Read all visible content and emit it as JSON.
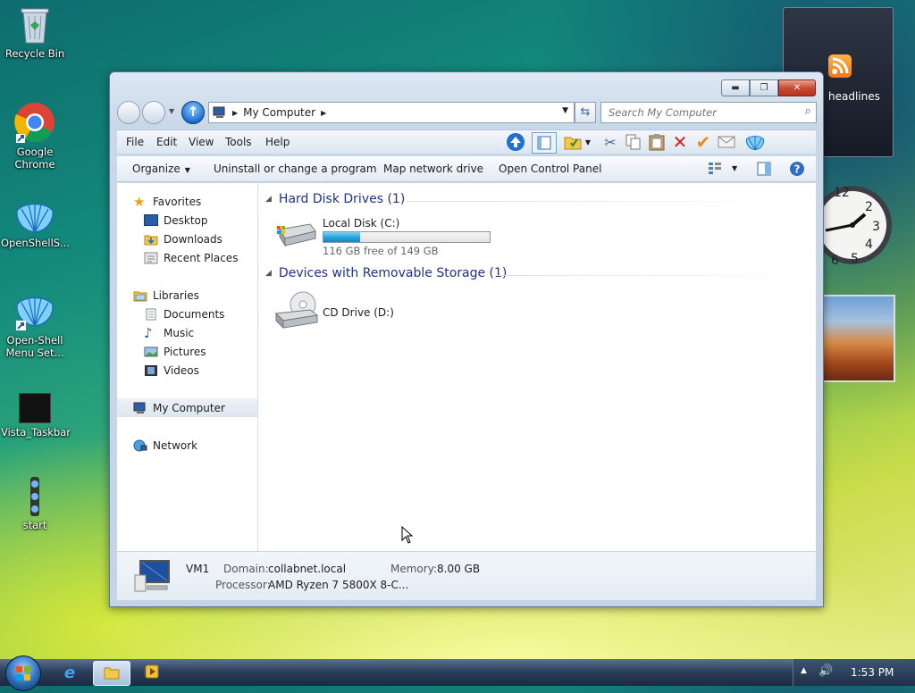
{
  "desktop": {
    "icons": [
      {
        "label": "Recycle Bin"
      },
      {
        "label": "Google Chrome"
      },
      {
        "label": "OpenShellS..."
      },
      {
        "label": "Open-Shell Menu Set..."
      },
      {
        "label": "Vista_Taskbar"
      },
      {
        "label": "start"
      }
    ]
  },
  "gadgets": {
    "headlines_label": "headlines"
  },
  "window": {
    "address": {
      "location": "My Computer"
    },
    "search": {
      "placeholder": "Search My Computer"
    },
    "menu": [
      "File",
      "Edit",
      "View",
      "Tools",
      "Help"
    ],
    "commands": {
      "organize": "Organize",
      "uninstall": "Uninstall or change a program",
      "map_drive": "Map network drive",
      "control_panel": "Open Control Panel"
    },
    "nav": {
      "favorites": "Favorites",
      "desktop": "Desktop",
      "downloads": "Downloads",
      "recent": "Recent Places",
      "libraries": "Libraries",
      "documents": "Documents",
      "music": "Music",
      "pictures": "Pictures",
      "videos": "Videos",
      "my_computer": "My Computer",
      "network": "Network"
    },
    "groups": {
      "hdd": "Hard Disk Drives (1)",
      "removable": "Devices with Removable Storage (1)"
    },
    "drives": {
      "c_name": "Local Disk (C:)",
      "c_free": "116 GB free of 149 GB",
      "c_used_fraction": 0.22,
      "d_name": "CD Drive (D:)"
    },
    "details": {
      "name": "VM1",
      "domain_label": "Domain:",
      "domain": "collabnet.local",
      "memory_label": "Memory:",
      "memory": "8.00 GB",
      "processor_label": "Processor:",
      "processor": "AMD Ryzen 7 5800X 8-C..."
    }
  },
  "taskbar": {
    "clock": "1:53 PM"
  }
}
